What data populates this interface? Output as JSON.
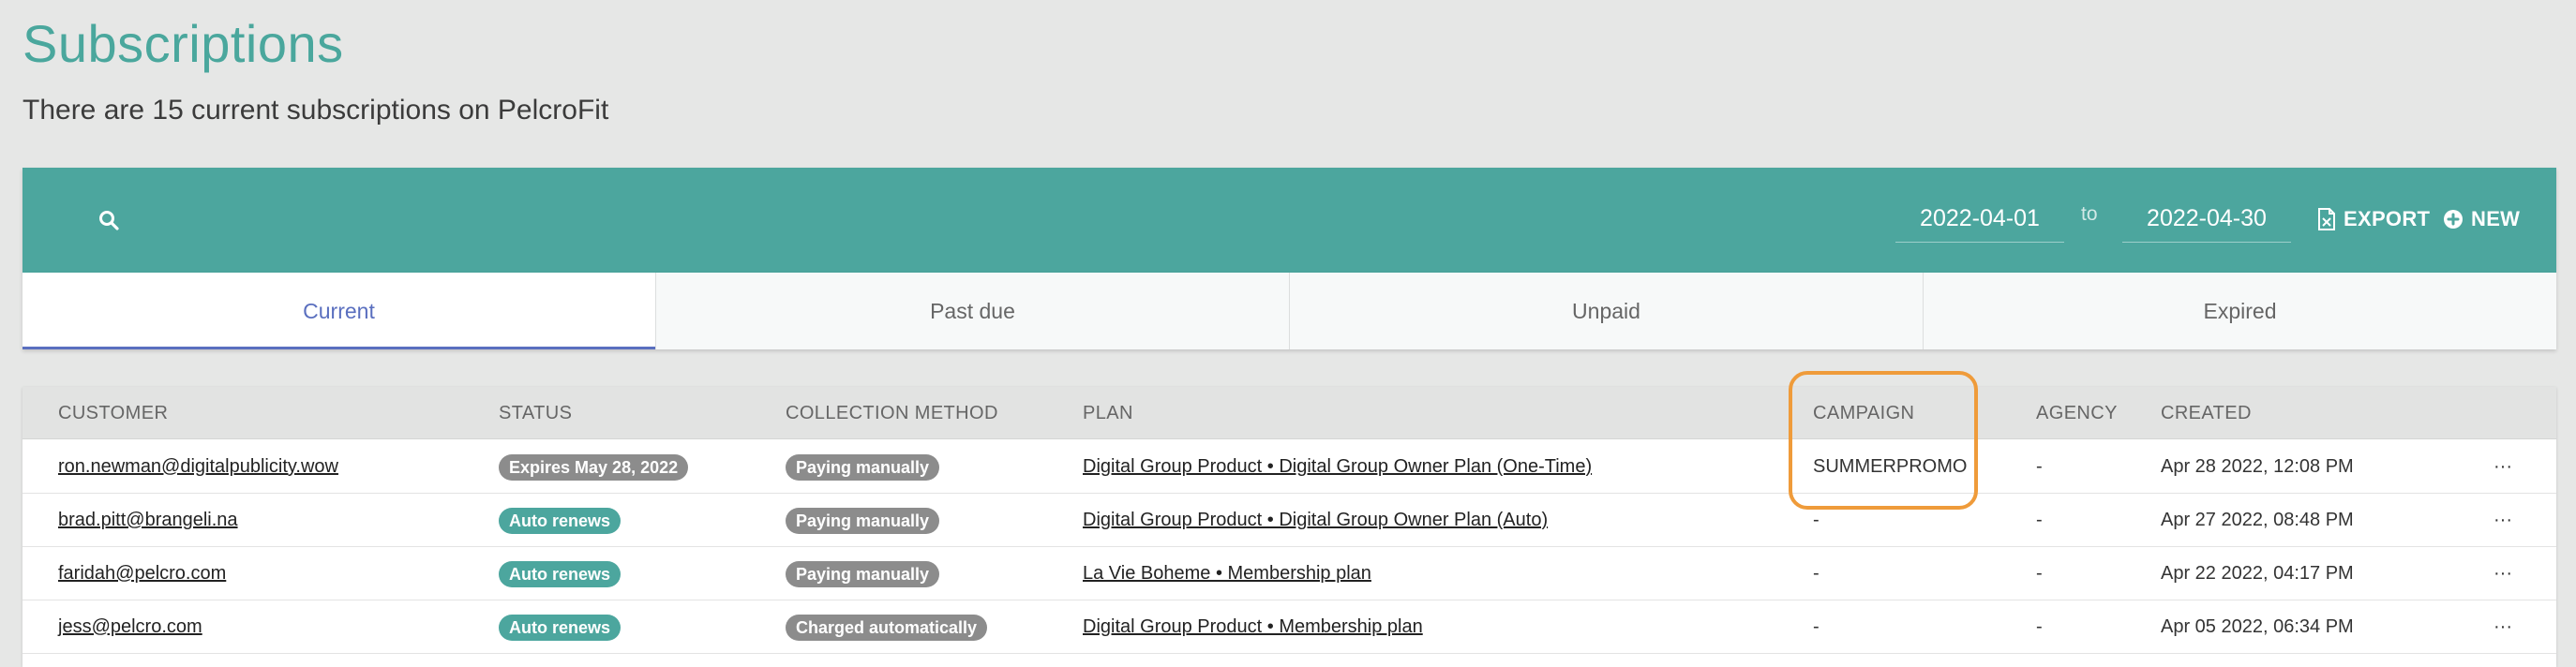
{
  "header": {
    "title": "Subscriptions",
    "subtitle": "There are 15 current subscriptions on PelcroFit"
  },
  "toolbar": {
    "search_icon": "search-icon",
    "date_from": "2022-04-01",
    "date_separator": "to",
    "date_to": "2022-04-30",
    "export_label": "EXPORT",
    "new_label": "NEW",
    "color": "#4ca69e"
  },
  "tabs": [
    {
      "label": "Current",
      "active": true
    },
    {
      "label": "Past due",
      "active": false
    },
    {
      "label": "Unpaid",
      "active": false
    },
    {
      "label": "Expired",
      "active": false
    }
  ],
  "table": {
    "columns": {
      "customer": "CUSTOMER",
      "status": "STATUS",
      "method": "COLLECTION METHOD",
      "plan": "PLAN",
      "campaign": "CAMPAIGN",
      "agency": "AGENCY",
      "created": "CREATED"
    },
    "rows": [
      {
        "customer": "ron.newman@digitalpublicity.wow",
        "status": "Expires May 28, 2022",
        "status_color": "gray",
        "method": "Paying manually",
        "plan": "Digital Group Product • Digital Group Owner Plan (One-Time)",
        "campaign": "SUMMERPROMO",
        "agency": "-",
        "created": "Apr 28 2022, 12:08 PM",
        "menu": "···"
      },
      {
        "customer": "brad.pitt@brangeli.na",
        "status": "Auto renews",
        "status_color": "teal",
        "method": "Paying manually",
        "plan": "Digital Group Product • Digital Group Owner Plan (Auto)",
        "campaign": "-",
        "agency": "-",
        "created": "Apr 27 2022, 08:48 PM",
        "menu": "···"
      },
      {
        "customer": "faridah@pelcro.com",
        "status": "Auto renews",
        "status_color": "teal",
        "method": "Paying manually",
        "plan": "La Vie Boheme • Membership plan",
        "campaign": "-",
        "agency": "-",
        "created": "Apr 22 2022, 04:17 PM",
        "menu": "···"
      },
      {
        "customer": "jess@pelcro.com",
        "status": "Auto renews",
        "status_color": "teal",
        "method": "Charged automatically",
        "plan": "Digital Group Product • Membership plan",
        "campaign": "-",
        "agency": "-",
        "created": "Apr 05 2022, 06:34 PM",
        "menu": "···"
      }
    ]
  },
  "annotation": {
    "highlight_color": "#ef9b3a"
  }
}
